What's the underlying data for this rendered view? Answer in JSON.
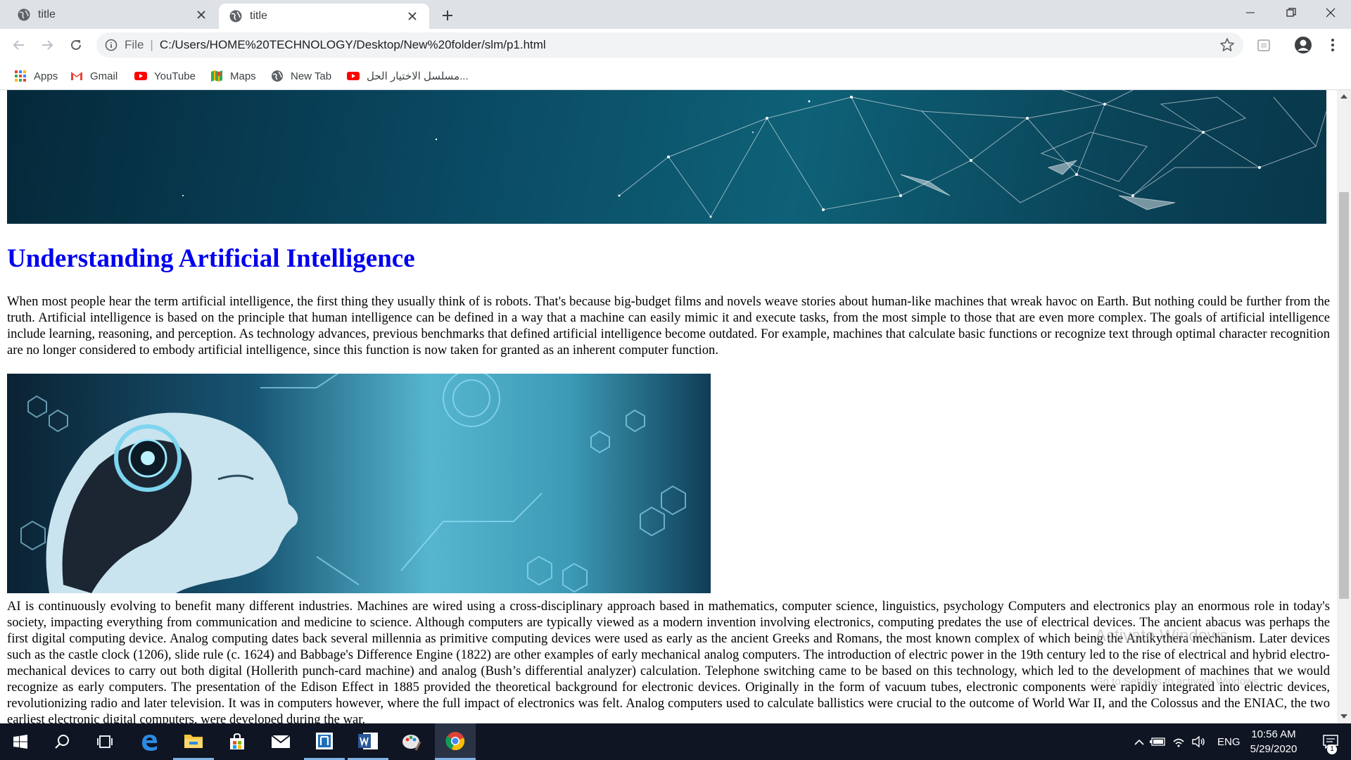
{
  "browser": {
    "tabs": [
      {
        "title": "title",
        "active": false
      },
      {
        "title": "title",
        "active": true
      }
    ],
    "address": {
      "scheme_label": "File",
      "url": "C:/Users/HOME%20TECHNOLOGY/Desktop/New%20folder/slm/p1.html"
    },
    "bookmarks": [
      {
        "label": "Apps",
        "icon": "apps-grid-icon"
      },
      {
        "label": "Gmail",
        "icon": "gmail-icon"
      },
      {
        "label": "YouTube",
        "icon": "youtube-icon"
      },
      {
        "label": "Maps",
        "icon": "maps-icon"
      },
      {
        "label": "New Tab",
        "icon": "globe-icon"
      },
      {
        "label": "مسلسل الاختيار الحل...",
        "icon": "youtube-icon"
      }
    ]
  },
  "page": {
    "heading": "Understanding Artificial Intelligence",
    "paragraph1": "When most people hear the term artificial intelligence, the first thing they usually think of is robots. That's because big-budget films and novels weave stories about human-like machines that wreak havoc on Earth. But nothing could be further from the truth. Artificial intelligence is based on the principle that human intelligence can be defined in a way that a machine can easily mimic it and execute tasks, from the most simple to those that are even more complex. The goals of artificial intelligence include learning, reasoning, and perception. As technology advances, previous benchmarks that defined artificial intelligence become outdated. For example, machines that calculate basic functions or recognize text through optimal character recognition are no longer considered to embody artificial intelligence, since this function is now taken for granted as an inherent computer function.",
    "paragraph2": "AI is continuously evolving to benefit many different industries. Machines are wired using a cross-disciplinary approach based in mathematics, computer science, linguistics, psychology Computers and electronics play an enormous role in today's society, impacting everything from communication and medicine to science. Although computers are typically viewed as a modern invention involving electronics, computing predates the use of electrical devices. The ancient abacus was perhaps the first digital computing device. Analog computing dates back several millennia as primitive computing devices were used as early as the ancient Greeks and Romans, the most known complex of which being the Antikythera mechanism. Later devices such as the castle clock (1206), slide rule (c. 1624) and Babbage's Difference Engine (1822) are other examples of early mechanical analog computers. The introduction of electric power in the 19th century led to the rise of electrical and hybrid electro-mechanical devices to carry out both digital (Hollerith punch-card machine) and analog (Bush’s differential analyzer) calculation. Telephone switching came to be based on this technology, which led to the development of machines that we would recognize as early computers. The presentation of the Edison Effect in 1885 provided the theoretical background for electronic devices. Originally in the form of vacuum tubes, electronic components were rapidly integrated into electric devices, revolutionizing radio and later television. It was in computers however, where the full impact of electronics was felt. Analog computers used to calculate ballistics were crucial to the outcome of World War II, and the Colossus and the ENIAC, the two earliest electronic digital computers, were developed during the war."
  },
  "watermark": {
    "line1": "Activate Windows",
    "line2": "Go to Settings to activate Windows."
  },
  "taskbar": {
    "apps": [
      "windows-start-icon",
      "search-icon",
      "task-view-icon",
      "edge-icon",
      "file-explorer-icon",
      "store-icon",
      "mail-icon",
      "tablet-app-icon",
      "word-icon",
      "paint-icon",
      "chrome-icon"
    ],
    "language": "ENG",
    "time": "10:56 AM",
    "date": "5/29/2020",
    "notification_count": "1"
  },
  "colors": {
    "link_heading": "#0000ee",
    "taskbar_bg": "#0f1523",
    "tabstrip_bg": "#dee1e6"
  }
}
